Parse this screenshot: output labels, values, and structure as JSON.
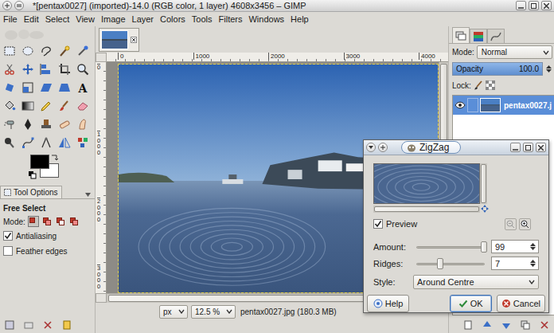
{
  "window": {
    "title": "*[pentax0027] (imported)-14.0 (RGB color, 1 layer) 4608x3456 – GIMP"
  },
  "menu": [
    "File",
    "Edit",
    "Select",
    "View",
    "Image",
    "Layer",
    "Colors",
    "Tools",
    "Filters",
    "Windows",
    "Help"
  ],
  "toolbox": {
    "text_tool_glyph": "A",
    "foreground": "#000000",
    "background": "#ffffff"
  },
  "tool_options": {
    "tab": "Tool Options",
    "tool": "Free Select",
    "mode_label": "Mode:",
    "modes": [
      {
        "selected": true
      },
      {
        "selected": false
      },
      {
        "selected": false
      },
      {
        "selected": false
      }
    ],
    "options": [
      {
        "label": "Antialiasing",
        "checked": true
      },
      {
        "label": "Feather edges",
        "checked": false
      }
    ]
  },
  "image_tabs": [
    {
      "selected": true
    }
  ],
  "rulers": {
    "top": [
      "0",
      "1000",
      "2000",
      "3000",
      "4000"
    ],
    "left": [
      "0",
      "1000",
      "2000",
      "3000"
    ]
  },
  "status_bar": {
    "unit": "px",
    "zoom": "12.5 %",
    "info": "pentax0027.jpg (180.3 MB)"
  },
  "dock_tabs": [
    {
      "selected": true
    },
    {
      "selected": false
    },
    {
      "selected": false
    }
  ],
  "layers_panel": {
    "mode_label": "Mode:",
    "mode": "Normal",
    "opacity_label": "Opacity",
    "opacity": "100.0",
    "opacity_level": 1,
    "lock_label": "Lock:",
    "layers": [
      {
        "name": "pentax0027.j",
        "visible": true,
        "selected": true
      }
    ]
  },
  "dialog": {
    "title": "ZigZag",
    "preview": {
      "label": "Preview",
      "checked": true
    },
    "sliders": [
      {
        "label": "Amount:",
        "value": "99",
        "level": 0.99
      },
      {
        "label": "Ridges:",
        "value": "7",
        "level": 0.35
      }
    ],
    "style": {
      "label": "Style:",
      "value": "Around Centre"
    },
    "buttons": [
      {
        "label": "Help",
        "default": false
      },
      {
        "label": "OK",
        "default": true
      },
      {
        "label": "Cancel",
        "default": false
      }
    ]
  }
}
